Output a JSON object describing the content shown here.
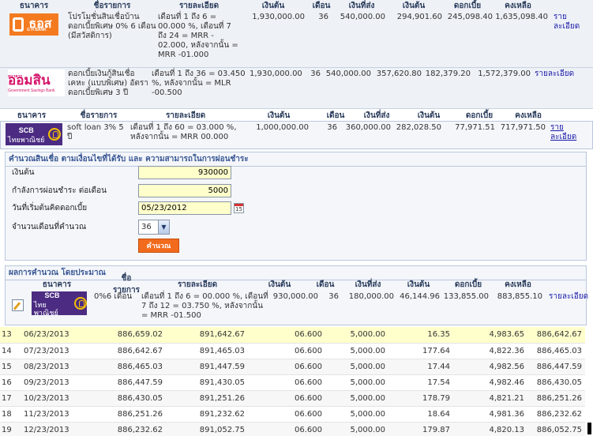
{
  "headers": {
    "bank": "ธนาคาร",
    "product": "ชื่อรายการ",
    "detail": "รายละเอียด",
    "principal": "เงินต้น",
    "months": "เดือน",
    "payment": "เงินที่ส่ง",
    "paid_principal": "เงินต้น",
    "interest": "ดอกเบี้ย",
    "remaining": "คงเหลือ"
  },
  "banks": [
    {
      "logo": "gh-bank-logo",
      "logo_text": "ธอส",
      "logo_sub": "G H BANK",
      "product": "โปรโมชั่นสินเชื่อบ้าน ดอกเบี้ยพิเศษ 0% 6 เดือน (มีสวัสดิการ)",
      "detail": "เดือนที่ 1 ถึง 6 = 00.000 %, เดือนที่ 7 ถึง 24 = MRR - 02.000, หลังจากนั้น = MRR -01.000",
      "principal": "1,930,000.00",
      "months": "36",
      "payment": "540,000.00",
      "paid_principal": "294,901.60",
      "interest": "245,098.40",
      "remaining": "1,635,098.40",
      "link": "รายละเอียด"
    },
    {
      "logo": "gsb-logo",
      "logo_text": "ออมสิน",
      "logo_small": "ธนาคาร",
      "logo_sub": "Government Savings Bank",
      "product": "ดอกเบี้ยเงินกู้สินเชื่อเคหะ (แบบพิเศษ) อัตราดอกเบี้ยพิเศษ 3 ปี",
      "detail": "เดือนที่ 1 ถึง 36 = 03.450 %, หลังจากนั้น = MLR -00.500",
      "principal": "1,930,000.00",
      "months": "36",
      "payment": "540,000.00",
      "paid_principal": "357,620.80",
      "interest": "182,379.20",
      "remaining": "1,572,379.00",
      "link": "รายละเอียด"
    },
    {
      "logo": "scb-logo",
      "logo_text": "SCB",
      "logo_sub": "ไทยพาณิชย์",
      "product": "soft loan 3% 5 ปี",
      "detail": "เดือนที่ 1 ถึง 60 = 03.000 %, หลังจากนั้น = MRR 00.000",
      "principal": "1,000,000.00",
      "months": "36",
      "payment": "360,000.00",
      "paid_principal": "282,028.50",
      "interest": "77,971.51",
      "remaining": "717,971.50",
      "link": "รายละเอียด"
    }
  ],
  "calculator": {
    "title": "คำนวณสินเชื่อ ตามเงื่อนไขที่ได้รับ และ ความสามารถในการผ่อนชำระ",
    "principal_label": "เงินต้น",
    "principal_value": "930000",
    "payment_label": "กำลังการผ่อนชำระ ต่อเดือน",
    "payment_value": "5000",
    "start_label": "วันที่เริ่มต้นคิดดอกเบี้ย",
    "start_value": "05/23/2012",
    "months_label": "จำนวนเดือนที่คำนวณ",
    "months_value": "36",
    "calc_button": "คำนวณ",
    "calendar_glyph": "15"
  },
  "result": {
    "title": "ผลการคำนวณ โดยประมาณ",
    "row": {
      "logo_text": "SCB",
      "logo_sub": "ไทยพาณิชย์",
      "product": "0%6 เดือน",
      "detail": "เดือนที่ 1 ถึง 6 = 00.000 %, เดือนที่ 7 ถึง 12 = 03.750 %, หลังจากนั้น = MRR -01.500",
      "principal": "930,000.00",
      "months": "36",
      "payment": "180,000.00",
      "paid_principal": "46,144.96",
      "interest": "133,855.00",
      "remaining": "883,855.10",
      "link": "รายละเอียด"
    }
  },
  "schedule": [
    {
      "no": "13",
      "date": "06/23/2013",
      "begin": "886,659.02",
      "end": "891,642.67",
      "rate": "06.600",
      "pay": "5,000.00",
      "princ": "16.35",
      "int": "4,983.65",
      "bal": "886,642.67"
    },
    {
      "no": "14",
      "date": "07/23/2013",
      "begin": "886,642.67",
      "end": "891,465.03",
      "rate": "06.600",
      "pay": "5,000.00",
      "princ": "177.64",
      "int": "4,822.36",
      "bal": "886,465.03"
    },
    {
      "no": "15",
      "date": "08/23/2013",
      "begin": "886,465.03",
      "end": "891,447.59",
      "rate": "06.600",
      "pay": "5,000.00",
      "princ": "17.44",
      "int": "4,982.56",
      "bal": "886,447.59"
    },
    {
      "no": "16",
      "date": "09/23/2013",
      "begin": "886,447.59",
      "end": "891,430.05",
      "rate": "06.600",
      "pay": "5,000.00",
      "princ": "17.54",
      "int": "4,982.46",
      "bal": "886,430.05"
    },
    {
      "no": "17",
      "date": "10/23/2013",
      "begin": "886,430.05",
      "end": "891,251.26",
      "rate": "06.600",
      "pay": "5,000.00",
      "princ": "178.79",
      "int": "4,821.21",
      "bal": "886,251.26"
    },
    {
      "no": "18",
      "date": "11/23/2013",
      "begin": "886,251.26",
      "end": "891,232.62",
      "rate": "06.600",
      "pay": "5,000.00",
      "princ": "18.64",
      "int": "4,981.36",
      "bal": "886,232.62"
    },
    {
      "no": "19",
      "date": "12/23/2013",
      "begin": "886,232.62",
      "end": "891,052.75",
      "rate": "06.600",
      "pay": "5,000.00",
      "princ": "179.87",
      "int": "4,820.13",
      "bal": "886,052.75"
    }
  ]
}
